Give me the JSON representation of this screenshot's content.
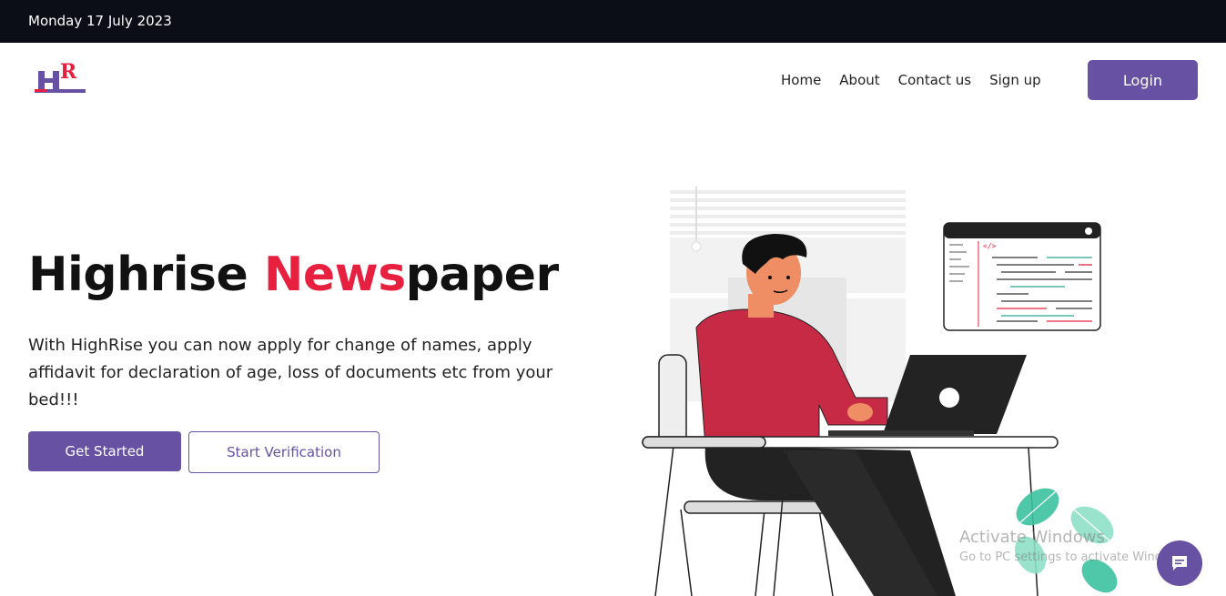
{
  "topbar": {
    "date": "Monday 17 July 2023"
  },
  "logo": {
    "text": "HR",
    "icon": "highrise-logo"
  },
  "nav": {
    "links": [
      "Home",
      "About",
      "Contact us",
      "Sign up"
    ],
    "login_label": "Login"
  },
  "hero": {
    "title_part1": "Highrise ",
    "title_accent": "News",
    "title_part2": "paper",
    "description": "With HighRise you can now apply for change of names, apply affidavit for declaration of age, loss of documents etc from your bed!!!",
    "primary_button": "Get Started",
    "secondary_button": "Start Verification"
  },
  "illustration": {
    "code_tag": "</>"
  },
  "watermark": {
    "title": "Activate Windows",
    "subtitle": "Go to PC settings to activate Windows."
  },
  "colors": {
    "brand": "#6651a3",
    "accent": "#e8203f",
    "topbar": "#0b0e17"
  }
}
